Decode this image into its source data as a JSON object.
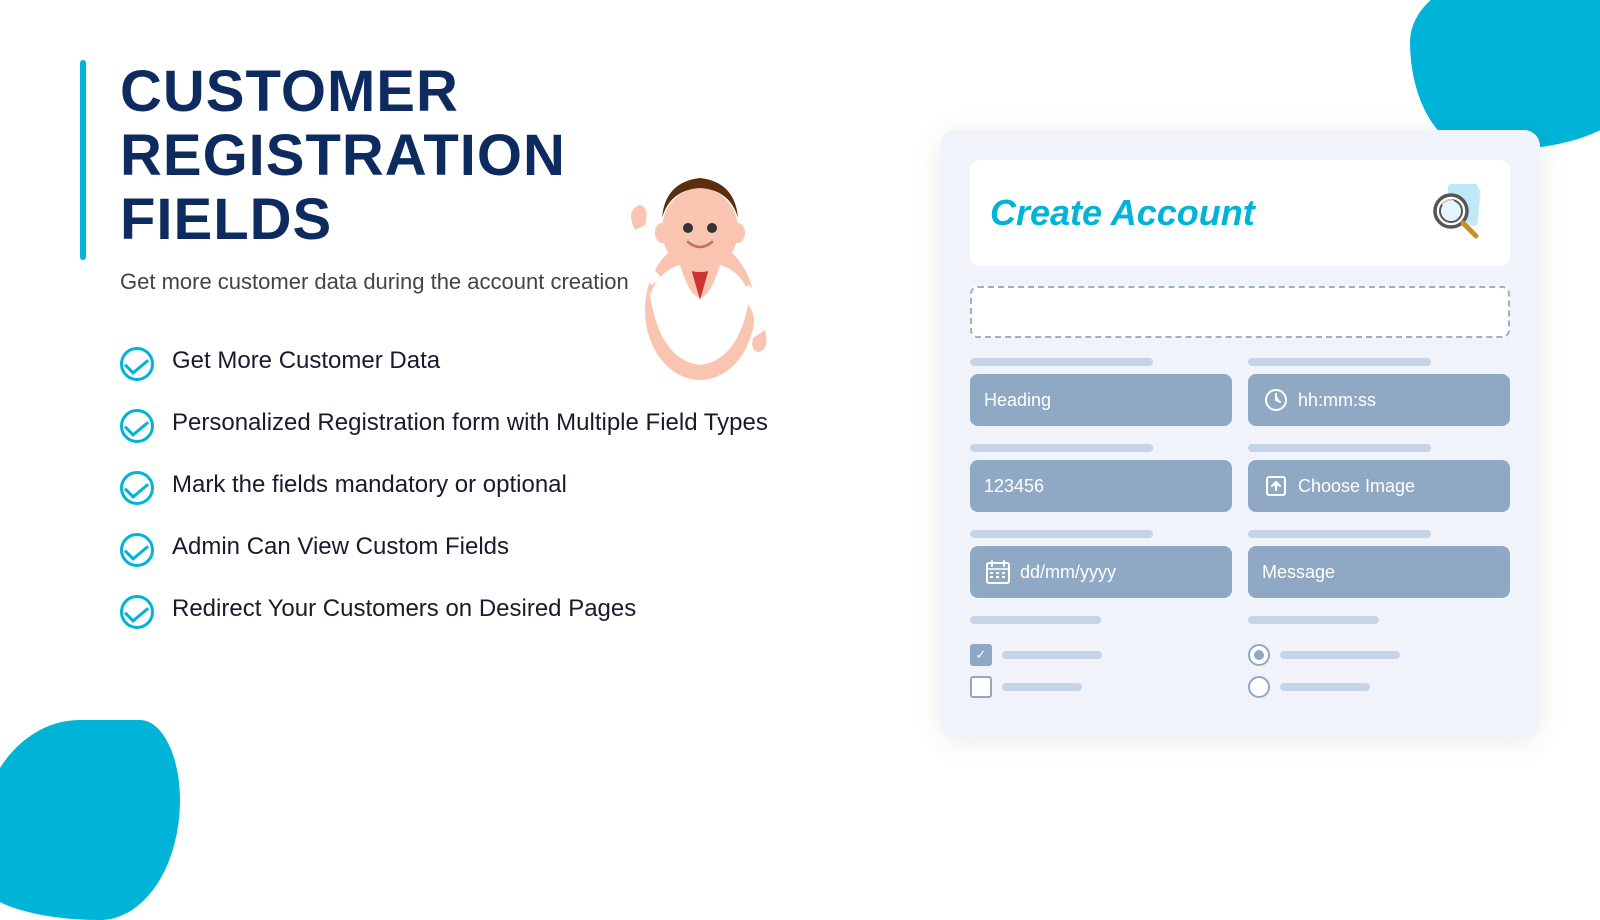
{
  "page": {
    "title": "Customer Registration Fields",
    "subtitle": "Get more customer data during the account creation"
  },
  "features": [
    {
      "id": 1,
      "text": "Get More Customer Data"
    },
    {
      "id": 2,
      "text": "Personalized Registration form with Multiple Field Types"
    },
    {
      "id": 3,
      "text": "Mark the fields mandatory or optional"
    },
    {
      "id": 4,
      "text": "Admin Can  View Custom Fields"
    },
    {
      "id": 5,
      "text": "Redirect Your Customers on Desired Pages"
    }
  ],
  "form": {
    "title": "Create Account",
    "fields": {
      "heading": "Heading",
      "time": "hh:mm:ss",
      "number": "123456",
      "image": "Choose Image",
      "date": "dd/mm/yyyy",
      "message": "Message"
    }
  },
  "colors": {
    "accent": "#00b4d8",
    "navy": "#0d2b5e",
    "field_bg": "#8fa8c4",
    "label_bg": "#c5d4e8"
  }
}
